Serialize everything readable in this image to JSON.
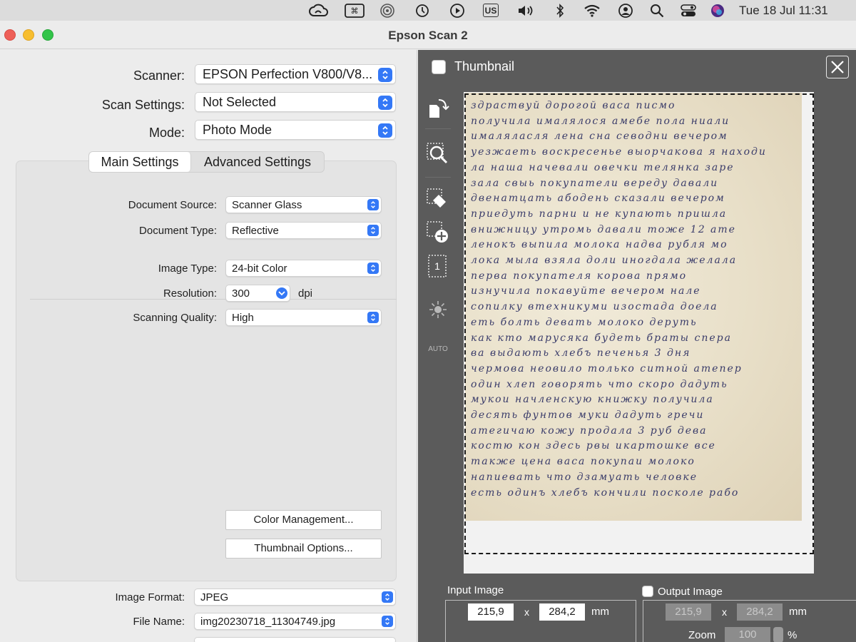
{
  "menubar": {
    "icons": [
      "creative-cloud-icon",
      "keyboard-shortcut-icon",
      "airplay-icon",
      "time-machine-icon",
      "play-icon",
      "input-source-icon",
      "volume-icon",
      "bluetooth-icon",
      "wifi-icon",
      "user-icon",
      "spotlight-search-icon",
      "control-center-icon",
      "siri-icon"
    ],
    "input_source": "US",
    "datetime": "Tue 18 Jul  11:31"
  },
  "window": {
    "title": "Epson Scan 2"
  },
  "left": {
    "scanner_label": "Scanner:",
    "scanner_value": "EPSON Perfection V800/V8...",
    "scan_settings_label": "Scan Settings:",
    "scan_settings_value": "Not Selected",
    "mode_label": "Mode:",
    "mode_value": "Photo Mode",
    "tabs": [
      "Main Settings",
      "Advanced Settings"
    ],
    "active_tab": "Main Settings",
    "document_source_label": "Document Source:",
    "document_source_value": "Scanner Glass",
    "document_type_label": "Document Type:",
    "document_type_value": "Reflective",
    "image_type_label": "Image Type:",
    "image_type_value": "24-bit Color",
    "resolution_label": "Resolution:",
    "resolution_value": "300",
    "resolution_unit": "dpi",
    "quality_label": "Scanning Quality:",
    "quality_value": "High",
    "color_mgmt_button": "Color Management...",
    "thumb_options_button": "Thumbnail Options...",
    "image_format_label": "Image Format:",
    "image_format_value": "JPEG",
    "file_name_label": "File Name:",
    "file_name_value": "img20230718_11304749.jpg"
  },
  "right": {
    "thumbnail_label": "Thumbnail",
    "thumbnail_checked": false,
    "tools": [
      "rotate-icon",
      "zoom-icon",
      "erase-selection-icon",
      "add-selection-icon",
      "select-all-frames-icon",
      "auto-exposure-icon"
    ],
    "frame_number": "1",
    "auto_label": "AUTO",
    "document_lines": [
      "здраствуй  дорогой  васа  писмо",
      "получила  ималялося  амебе  пола  ниали",
      "ималяласля  лена  сна  севодни  вечером",
      "уезжаеть  воскресенье  выорчакова  я находи",
      "ла  наша  начевали  овечки  телянка  заре",
      "зала  свыь  покупатели  вереду  давали",
      "двенатцать  абодень  сказали  вечером",
      "приедуть  парни  и  не  купають  пришла",
      "внижницу  утромь  давали  тоже  12  ате",
      "ленокъ  выпила  молока  надва  рубля  мо",
      "лока  мыла  взяла  доли  иногдала  желала",
      "перва  покупателя  корова  прямо",
      "изнучила  покавуйте  вечером  нале",
      "сопилку  втехникуми  изостада  доела",
      "еть  болть  девать  молоко  деруть",
      "как  кто  марусяка  будеть  браты  спера",
      "ва  выдають  хлебъ  печенья  3  дня",
      "чермова  неовило  только  ситной  атепер",
      "один  хлеп  говорять  что  скоро  дадуть",
      "мукои  начленскую  книжку  получила",
      "десять  фунтов  муки  дадуть  гречи",
      "атегичаю  кожу  продала  3  руб  дева",
      "костю  кон  здесь  рвы  икартошке  все",
      "также  цена  васа  покупаи  молоко",
      "напиевать  что  дзамуать  человке",
      "есть  одинъ  хлебъ  кончили  посколе  рабо"
    ],
    "input_image_label": "Input Image",
    "input_width": "215,9",
    "input_height": "284,2",
    "dim_separator": "x",
    "unit": "mm",
    "output_image_label": "Output Image",
    "output_checked": false,
    "output_width": "215,9",
    "output_height": "284,2",
    "zoom_label": "Zoom",
    "zoom_value": "100",
    "zoom_unit": "%"
  }
}
